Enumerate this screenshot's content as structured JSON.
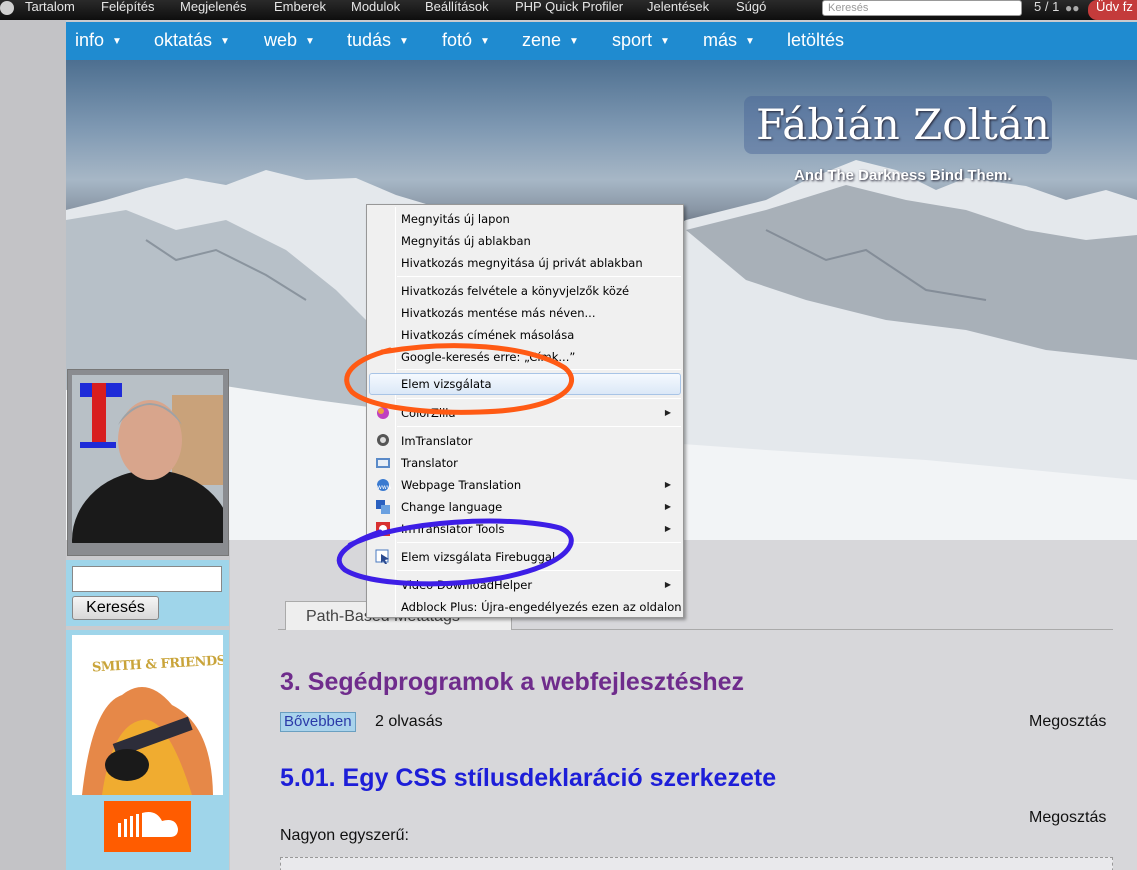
{
  "admin_bar": {
    "items": [
      "Tartalom",
      "Felépítés",
      "Megjelenés",
      "Emberek",
      "Modulok",
      "Beállítások",
      "PHP Quick Profiler",
      "Jelentések",
      "Súgó"
    ],
    "search_placeholder": "Keresés",
    "counter": "5 / 1",
    "greeting": "Üdv fz"
  },
  "nav": {
    "items": [
      "info",
      "oktatás",
      "web",
      "tudás",
      "fotó",
      "zene",
      "sport",
      "más",
      "letöltés"
    ]
  },
  "banner": {
    "site_title": "Fábián Zoltán",
    "slogan": "And The Darkness Bind Them."
  },
  "sidebar": {
    "search_button": "Keresés",
    "promo_text": "SMITH & FRIENDS"
  },
  "main": {
    "tab_label": "Path-Based Metatags",
    "post1": {
      "title": "3. Segédprogramok a webfejlesztéshez",
      "more": "Bővebben",
      "reads": "2 olvasás",
      "share": "Megosztás"
    },
    "post2": {
      "title": "5.01. Egy CSS stílusdeklaráció szerkezete",
      "share": "Megosztás",
      "body": "Nagyon egyszerű:"
    }
  },
  "context_menu": {
    "items": [
      {
        "label": "Megnyitás új lapon"
      },
      {
        "label": "Megnyitás új ablakban"
      },
      {
        "label": "Hivatkozás megnyitása új privát ablakban"
      },
      {
        "label": "Hivatkozás felvétele a könyvjelzők közé"
      },
      {
        "label": "Hivatkozás mentése más néven..."
      },
      {
        "label": "Hivatkozás címének másolása"
      },
      {
        "label": "Google-keresés erre: „Címk...”"
      },
      {
        "label": "Elem vizsgálata"
      },
      {
        "label": "ColorZilla"
      },
      {
        "label": "ImTranslator"
      },
      {
        "label": "Translator"
      },
      {
        "label": "Webpage Translation"
      },
      {
        "label": "Change language"
      },
      {
        "label": "ImTranslator Tools"
      },
      {
        "label": "Elem vizsgálata Firebuggal"
      },
      {
        "label": "Video DownloadHelper"
      },
      {
        "label": "Adblock Plus: Újra-engedélyezés ezen az oldalon"
      }
    ]
  },
  "colors": {
    "nav_bg": "#1f8bd0",
    "sidebar_bg": "#9fd5ea",
    "post1_title": "#6f2c8c",
    "post2_title": "#1d1ed8",
    "annotation_orange": "#ff5a14",
    "annotation_purple": "#3d1ee6",
    "admin_greet": "#c43b3b"
  }
}
